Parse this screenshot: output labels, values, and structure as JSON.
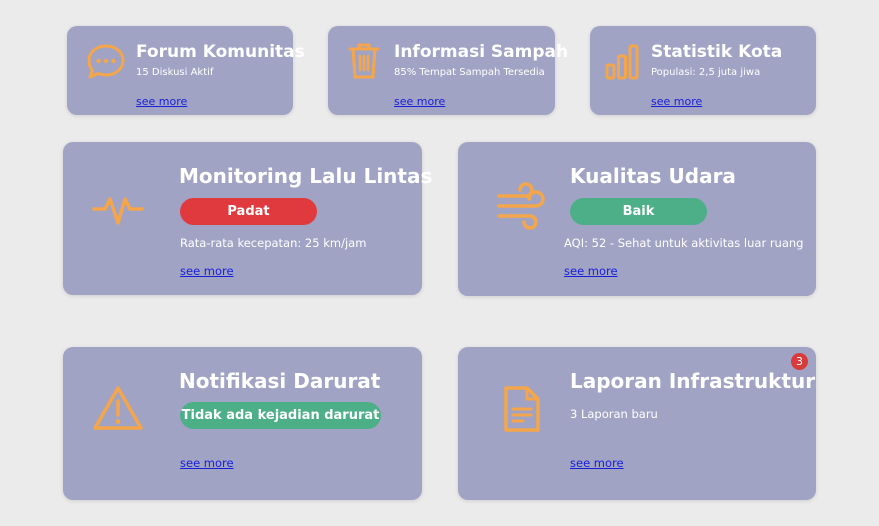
{
  "colors": {
    "background": "#ebebeb",
    "card": "#a0a3c4",
    "icon": "#f5a64a",
    "status_danger": "#e0393e",
    "status_ok": "#4caf88",
    "link": "#1a20d6",
    "badge": "#d93a3a"
  },
  "cards": {
    "forum": {
      "icon": "chat-bubble-icon",
      "title": "Forum Komunitas",
      "subtitle": "15 Diskusi Aktif",
      "link": "see more"
    },
    "sampah": {
      "icon": "trash-icon",
      "title": "Informasi Sampah",
      "subtitle": "85% Tempat Sampah Tersedia",
      "link": "see more"
    },
    "statistik": {
      "icon": "bar-chart-icon",
      "title": "Statistik Kota",
      "subtitle": "Populasi: 2,5 juta jiwa",
      "link": "see more"
    },
    "lalu_lintas": {
      "icon": "pulse-icon",
      "title": "Monitoring Lalu Lintas",
      "status": "Padat",
      "detail": "Rata-rata kecepatan: 25 km/jam",
      "link": "see more"
    },
    "udara": {
      "icon": "wind-icon",
      "title": "Kualitas Udara",
      "status": "Baik",
      "detail": "AQI: 52 - Sehat untuk aktivitas luar ruang",
      "link": "see more"
    },
    "darurat": {
      "icon": "warning-icon",
      "title": "Notifikasi Darurat",
      "status": "Tidak ada kejadian darurat",
      "link": "see more"
    },
    "infrastruktur": {
      "icon": "document-icon",
      "title": "Laporan Infrastruktur",
      "detail": "3 Laporan baru",
      "badge": "3",
      "link": "see more"
    }
  }
}
